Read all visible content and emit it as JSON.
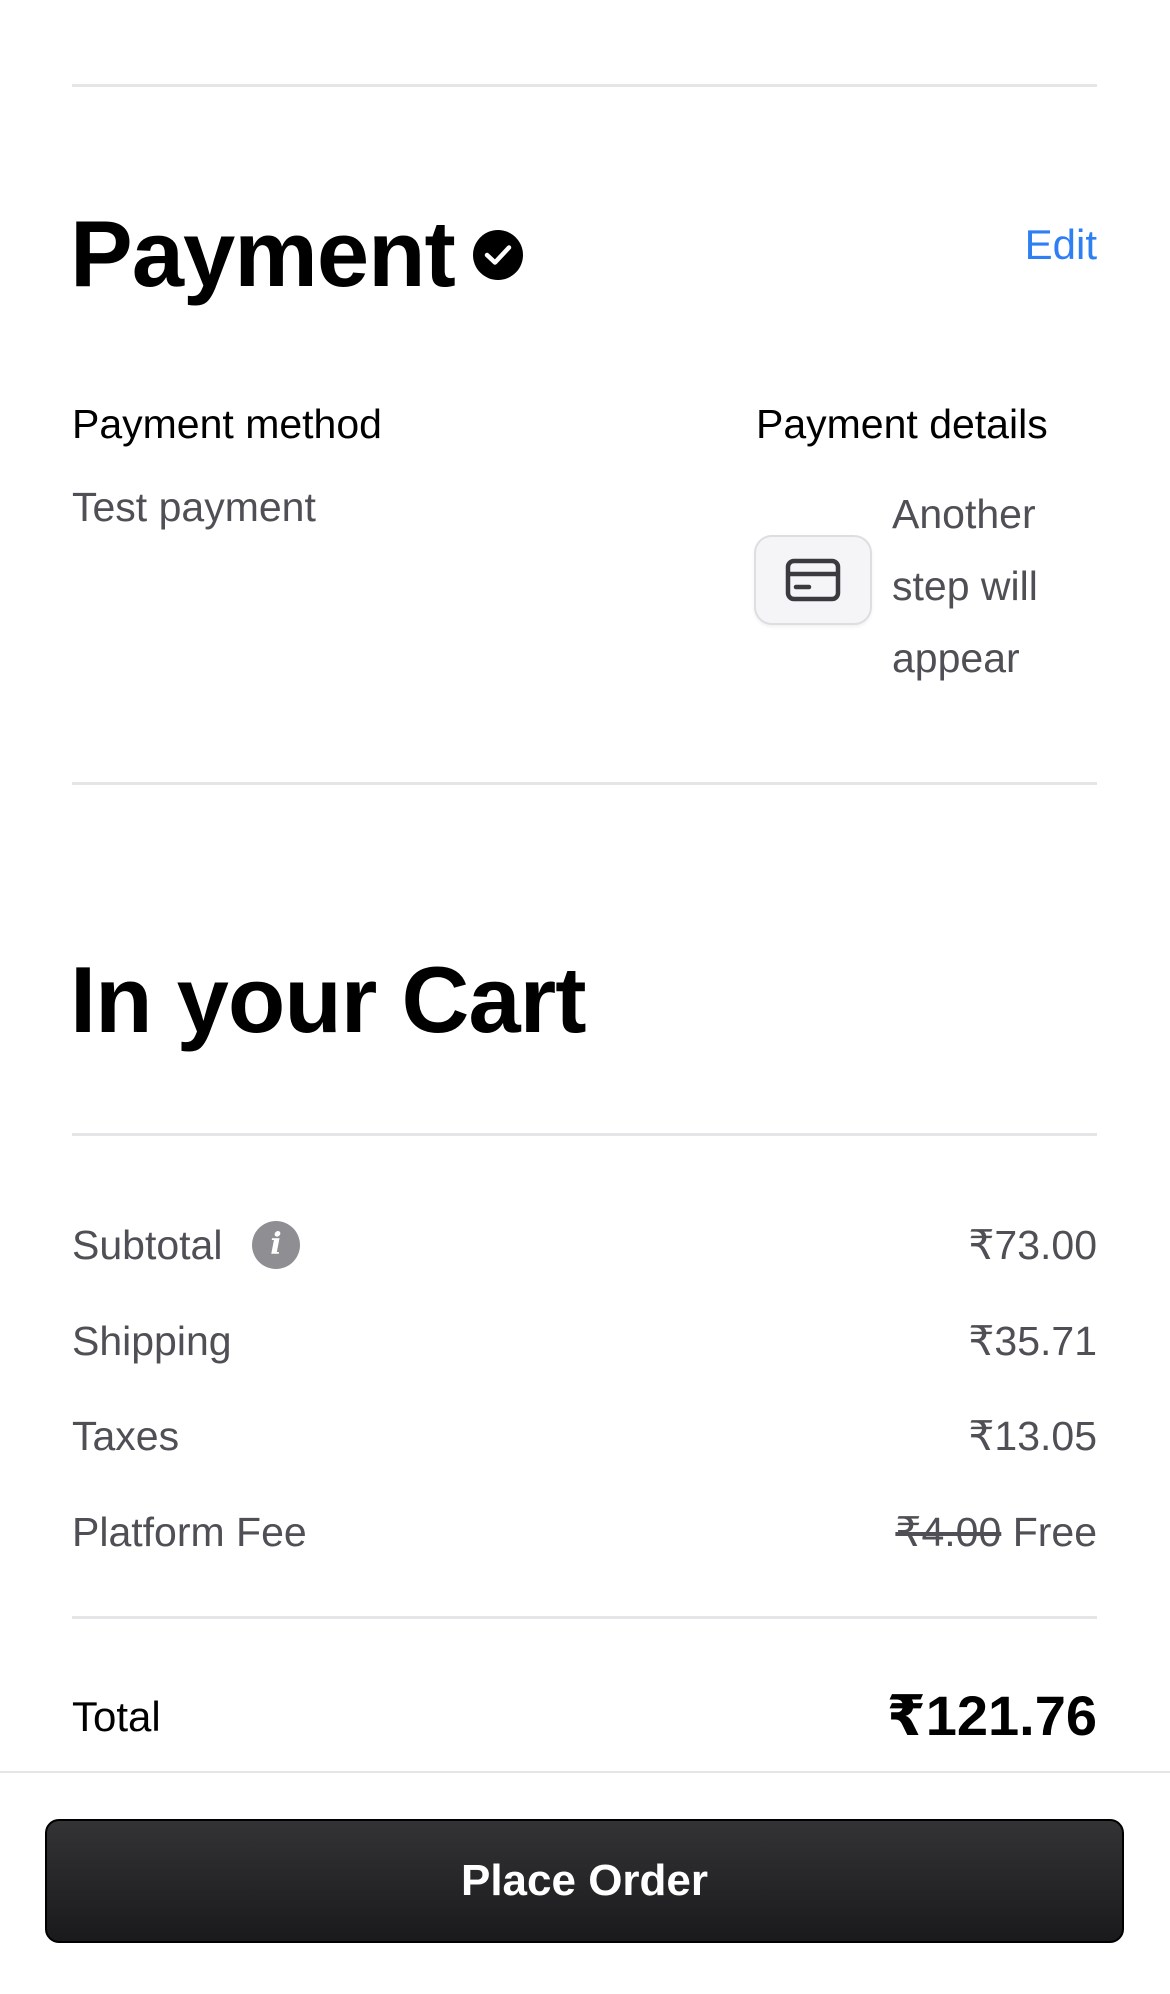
{
  "payment": {
    "title": "Payment",
    "edit_label": "Edit",
    "method_heading": "Payment method",
    "method_value": "Test payment",
    "details_heading": "Payment details",
    "details_note": "Another step will appear",
    "icons": {
      "completed": "check-circle-icon",
      "card": "credit-card-icon"
    }
  },
  "cart": {
    "title": "In your Cart",
    "rows": [
      {
        "label": "Subtotal",
        "value": "₹73.00",
        "info_icon": "info-icon"
      },
      {
        "label": "Shipping",
        "value": "₹35.71"
      },
      {
        "label": "Taxes",
        "value": "₹13.05"
      },
      {
        "label": "Platform Fee",
        "original_value": "₹4.00",
        "value": "Free"
      }
    ],
    "total_label": "Total",
    "total_value": "₹121.76"
  },
  "footer": {
    "place_order_label": "Place Order"
  },
  "colors": {
    "accent": "#2d7ff3",
    "text_primary": "#000000",
    "text_secondary": "#4f4f55",
    "divider": "#e5e5e7",
    "button_bg": "#1f1f21"
  }
}
